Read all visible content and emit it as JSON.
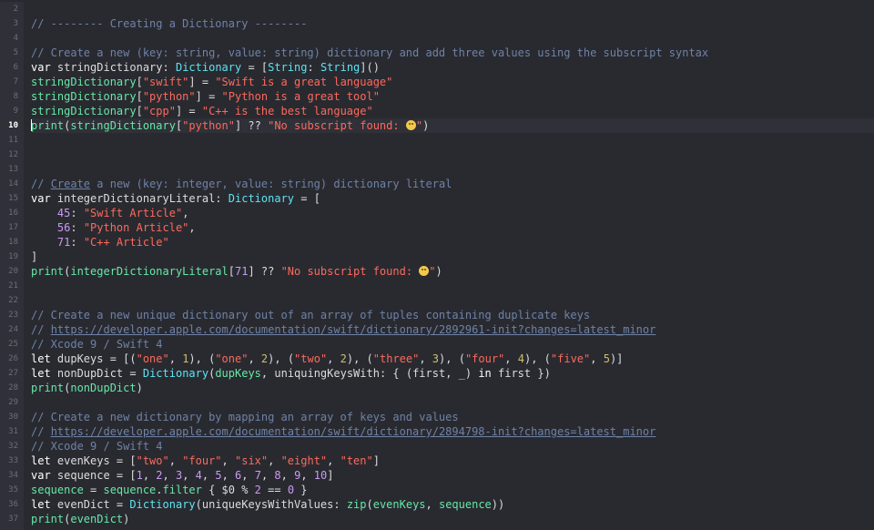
{
  "editor": {
    "line_numbers": [
      "2",
      "3",
      "4",
      "5",
      "6",
      "7",
      "8",
      "9",
      "10",
      "11",
      "12",
      "13",
      "14",
      "15",
      "16",
      "17",
      "18",
      "19",
      "20",
      "21",
      "22",
      "23",
      "24",
      "25",
      "26",
      "27",
      "28",
      "29",
      "30",
      "31",
      "32",
      "33",
      "34",
      "35",
      "36",
      "37"
    ],
    "current_line": "10",
    "lines": [
      [],
      [
        {
          "c": "cm",
          "t": "// -------- Creating a Dictionary --------"
        }
      ],
      [],
      [
        {
          "c": "cm",
          "t": "// Create a new (key: string, value: string) dictionary and add three values using the subscript syntax"
        }
      ],
      [
        {
          "c": "kw",
          "t": "var"
        },
        {
          "c": "pl",
          "t": " stringDictionary: "
        },
        {
          "c": "ty",
          "t": "Dictionary"
        },
        {
          "c": "pl",
          "t": " = ["
        },
        {
          "c": "ty",
          "t": "String"
        },
        {
          "c": "pl",
          "t": ": "
        },
        {
          "c": "ty",
          "t": "String"
        },
        {
          "c": "pl",
          "t": "]()"
        }
      ],
      [
        {
          "c": "id",
          "t": "stringDictionary"
        },
        {
          "c": "pl",
          "t": "["
        },
        {
          "c": "st",
          "t": "\"swift\""
        },
        {
          "c": "pl",
          "t": "] = "
        },
        {
          "c": "st",
          "t": "\"Swift is a great language\""
        }
      ],
      [
        {
          "c": "id",
          "t": "stringDictionary"
        },
        {
          "c": "pl",
          "t": "["
        },
        {
          "c": "st",
          "t": "\"python\""
        },
        {
          "c": "pl",
          "t": "] = "
        },
        {
          "c": "st",
          "t": "\"Python is a great tool\""
        }
      ],
      [
        {
          "c": "id",
          "t": "stringDictionary"
        },
        {
          "c": "pl",
          "t": "["
        },
        {
          "c": "st",
          "t": "\"cpp\""
        },
        {
          "c": "pl",
          "t": "] = "
        },
        {
          "c": "st",
          "t": "\"C++ is the best language\""
        }
      ],
      [
        {
          "c": "caret",
          "t": ""
        },
        {
          "c": "fn",
          "t": "print"
        },
        {
          "c": "pl",
          "t": "("
        },
        {
          "c": "id",
          "t": "stringDictionary"
        },
        {
          "c": "pl",
          "t": "["
        },
        {
          "c": "st",
          "t": "\"python\""
        },
        {
          "c": "pl",
          "t": "] ?? "
        },
        {
          "c": "st",
          "t": "\"No subscript found: "
        },
        {
          "c": "emoji",
          "t": ""
        },
        {
          "c": "st",
          "t": "\""
        },
        {
          "c": "pl",
          "t": ")"
        }
      ],
      [],
      [],
      [],
      [
        {
          "c": "cm",
          "t": "// "
        },
        {
          "c": "cm u",
          "t": "Create"
        },
        {
          "c": "cm",
          "t": " a new (key: integer, value: string) dictionary literal"
        }
      ],
      [
        {
          "c": "kw",
          "t": "var"
        },
        {
          "c": "pl",
          "t": " integerDictionaryLiteral: "
        },
        {
          "c": "ty",
          "t": "Dictionary"
        },
        {
          "c": "pl",
          "t": " = ["
        }
      ],
      [
        {
          "c": "pl",
          "t": "    "
        },
        {
          "c": "nu2",
          "t": "45"
        },
        {
          "c": "pl",
          "t": ": "
        },
        {
          "c": "st",
          "t": "\"Swift Article\""
        },
        {
          "c": "pl",
          "t": ","
        }
      ],
      [
        {
          "c": "pl",
          "t": "    "
        },
        {
          "c": "nu2",
          "t": "56"
        },
        {
          "c": "pl",
          "t": ": "
        },
        {
          "c": "st",
          "t": "\"Python Article\""
        },
        {
          "c": "pl",
          "t": ","
        }
      ],
      [
        {
          "c": "pl",
          "t": "    "
        },
        {
          "c": "nu2",
          "t": "71"
        },
        {
          "c": "pl",
          "t": ": "
        },
        {
          "c": "st",
          "t": "\"C++ Article\""
        }
      ],
      [
        {
          "c": "pl",
          "t": "]"
        }
      ],
      [
        {
          "c": "fn",
          "t": "print"
        },
        {
          "c": "pl",
          "t": "("
        },
        {
          "c": "id",
          "t": "integerDictionaryLiteral"
        },
        {
          "c": "pl",
          "t": "["
        },
        {
          "c": "nu2",
          "t": "71"
        },
        {
          "c": "pl",
          "t": "] ?? "
        },
        {
          "c": "st",
          "t": "\"No subscript found: "
        },
        {
          "c": "emoji",
          "t": ""
        },
        {
          "c": "st",
          "t": "\""
        },
        {
          "c": "pl",
          "t": ")"
        }
      ],
      [],
      [],
      [
        {
          "c": "cm",
          "t": "// Create a new unique dictionary out of an array of tuples containing duplicate keys"
        }
      ],
      [
        {
          "c": "cm",
          "t": "// "
        },
        {
          "c": "cm u",
          "t": "https://developer.apple.com/documentation/swift/dictionary/2892961-init?changes=latest_minor"
        }
      ],
      [
        {
          "c": "cm",
          "t": "// Xcode 9 / Swift 4"
        }
      ],
      [
        {
          "c": "kw",
          "t": "let"
        },
        {
          "c": "pl",
          "t": " dupKeys = [("
        },
        {
          "c": "st",
          "t": "\"one\""
        },
        {
          "c": "pl",
          "t": ", "
        },
        {
          "c": "nu",
          "t": "1"
        },
        {
          "c": "pl",
          "t": "), ("
        },
        {
          "c": "st",
          "t": "\"one\""
        },
        {
          "c": "pl",
          "t": ", "
        },
        {
          "c": "nu",
          "t": "2"
        },
        {
          "c": "pl",
          "t": "), ("
        },
        {
          "c": "st",
          "t": "\"two\""
        },
        {
          "c": "pl",
          "t": ", "
        },
        {
          "c": "nu",
          "t": "2"
        },
        {
          "c": "pl",
          "t": "), ("
        },
        {
          "c": "st",
          "t": "\"three\""
        },
        {
          "c": "pl",
          "t": ", "
        },
        {
          "c": "nu",
          "t": "3"
        },
        {
          "c": "pl",
          "t": "), ("
        },
        {
          "c": "st",
          "t": "\"four\""
        },
        {
          "c": "pl",
          "t": ", "
        },
        {
          "c": "nu",
          "t": "4"
        },
        {
          "c": "pl",
          "t": "), ("
        },
        {
          "c": "st",
          "t": "\"five\""
        },
        {
          "c": "pl",
          "t": ", "
        },
        {
          "c": "nu",
          "t": "5"
        },
        {
          "c": "pl",
          "t": ")]"
        }
      ],
      [
        {
          "c": "kw",
          "t": "let"
        },
        {
          "c": "pl",
          "t": " nonDupDict = "
        },
        {
          "c": "ty",
          "t": "Dictionary"
        },
        {
          "c": "pl",
          "t": "("
        },
        {
          "c": "id",
          "t": "dupKeys"
        },
        {
          "c": "pl",
          "t": ", uniquingKeysWith: { (first, _) "
        },
        {
          "c": "kw",
          "t": "in"
        },
        {
          "c": "pl",
          "t": " first })"
        }
      ],
      [
        {
          "c": "fn",
          "t": "print"
        },
        {
          "c": "pl",
          "t": "("
        },
        {
          "c": "id",
          "t": "nonDupDict"
        },
        {
          "c": "pl",
          "t": ")"
        }
      ],
      [],
      [
        {
          "c": "cm",
          "t": "// Create a new dictionary by mapping an array of keys and values"
        }
      ],
      [
        {
          "c": "cm",
          "t": "// "
        },
        {
          "c": "cm u",
          "t": "https://developer.apple.com/documentation/swift/dictionary/2894798-init?changes=latest_minor"
        }
      ],
      [
        {
          "c": "cm",
          "t": "// Xcode 9 / Swift 4"
        }
      ],
      [
        {
          "c": "kw",
          "t": "let"
        },
        {
          "c": "pl",
          "t": " evenKeys = ["
        },
        {
          "c": "st",
          "t": "\"two\""
        },
        {
          "c": "pl",
          "t": ", "
        },
        {
          "c": "st",
          "t": "\"four\""
        },
        {
          "c": "pl",
          "t": ", "
        },
        {
          "c": "st",
          "t": "\"six\""
        },
        {
          "c": "pl",
          "t": ", "
        },
        {
          "c": "st",
          "t": "\"eight\""
        },
        {
          "c": "pl",
          "t": ", "
        },
        {
          "c": "st",
          "t": "\"ten\""
        },
        {
          "c": "pl",
          "t": "]"
        }
      ],
      [
        {
          "c": "kw",
          "t": "var"
        },
        {
          "c": "pl",
          "t": " sequence = ["
        },
        {
          "c": "nu2",
          "t": "1"
        },
        {
          "c": "pl",
          "t": ", "
        },
        {
          "c": "nu2",
          "t": "2"
        },
        {
          "c": "pl",
          "t": ", "
        },
        {
          "c": "nu2",
          "t": "3"
        },
        {
          "c": "pl",
          "t": ", "
        },
        {
          "c": "nu2",
          "t": "4"
        },
        {
          "c": "pl",
          "t": ", "
        },
        {
          "c": "nu2",
          "t": "5"
        },
        {
          "c": "pl",
          "t": ", "
        },
        {
          "c": "nu2",
          "t": "6"
        },
        {
          "c": "pl",
          "t": ", "
        },
        {
          "c": "nu2",
          "t": "7"
        },
        {
          "c": "pl",
          "t": ", "
        },
        {
          "c": "nu2",
          "t": "8"
        },
        {
          "c": "pl",
          "t": ", "
        },
        {
          "c": "nu2",
          "t": "9"
        },
        {
          "c": "pl",
          "t": ", "
        },
        {
          "c": "nu2",
          "t": "10"
        },
        {
          "c": "pl",
          "t": "]"
        }
      ],
      [
        {
          "c": "id",
          "t": "sequence"
        },
        {
          "c": "pl",
          "t": " = "
        },
        {
          "c": "id",
          "t": "sequence"
        },
        {
          "c": "pl",
          "t": "."
        },
        {
          "c": "fn",
          "t": "filter"
        },
        {
          "c": "pl",
          "t": " { $0 % "
        },
        {
          "c": "nu2",
          "t": "2"
        },
        {
          "c": "pl",
          "t": " == "
        },
        {
          "c": "nu2",
          "t": "0"
        },
        {
          "c": "pl",
          "t": " }"
        }
      ],
      [
        {
          "c": "kw",
          "t": "let"
        },
        {
          "c": "pl",
          "t": " evenDict = "
        },
        {
          "c": "ty",
          "t": "Dictionary"
        },
        {
          "c": "pl",
          "t": "(uniqueKeysWithValues: "
        },
        {
          "c": "fn",
          "t": "zip"
        },
        {
          "c": "pl",
          "t": "("
        },
        {
          "c": "id",
          "t": "evenKeys"
        },
        {
          "c": "pl",
          "t": ", "
        },
        {
          "c": "id",
          "t": "sequence"
        },
        {
          "c": "pl",
          "t": "))"
        }
      ],
      [
        {
          "c": "fn",
          "t": "print"
        },
        {
          "c": "pl",
          "t": "("
        },
        {
          "c": "id",
          "t": "evenDict"
        },
        {
          "c": "pl",
          "t": ")"
        }
      ],
      []
    ]
  }
}
